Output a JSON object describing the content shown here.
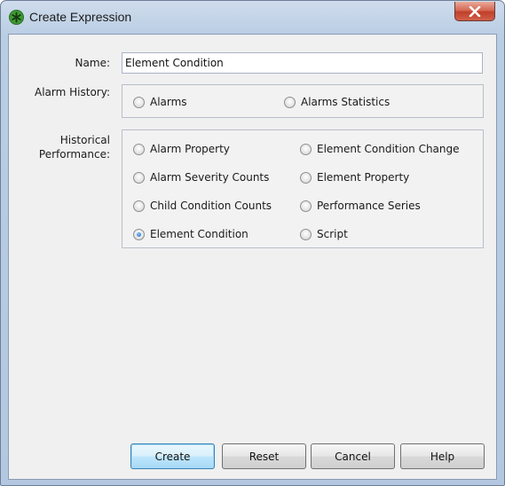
{
  "window": {
    "title": "Create Expression"
  },
  "form": {
    "name_label": "Name:",
    "name_value": "Element Condition",
    "alarm_history_label": "Alarm History:",
    "historical_label_line1": "Historical",
    "historical_label_line2": "Performance:"
  },
  "alarm_history": {
    "options": [
      {
        "label": "Alarms",
        "checked": false
      },
      {
        "label": "Alarms Statistics",
        "checked": false
      }
    ]
  },
  "historical_performance": {
    "options": [
      {
        "label": "Alarm Property",
        "checked": false
      },
      {
        "label": "Element Condition Change",
        "checked": false
      },
      {
        "label": "Alarm Severity Counts",
        "checked": false
      },
      {
        "label": "Element Property",
        "checked": false
      },
      {
        "label": "Child Condition Counts",
        "checked": false
      },
      {
        "label": "Performance Series",
        "checked": false
      },
      {
        "label": "Element Condition",
        "checked": true
      },
      {
        "label": "Script",
        "checked": false
      }
    ]
  },
  "buttons": {
    "create": "Create",
    "reset": "Reset",
    "cancel": "Cancel",
    "help": "Help"
  },
  "colors": {
    "title_bar": "#c4d5e8",
    "close_button": "#c8503c",
    "dialog_background": "#f0f0f0",
    "radio_selected": "#1c5fb8"
  },
  "icons": {
    "app": "green-asterisk-icon",
    "close": "close-x-icon"
  }
}
